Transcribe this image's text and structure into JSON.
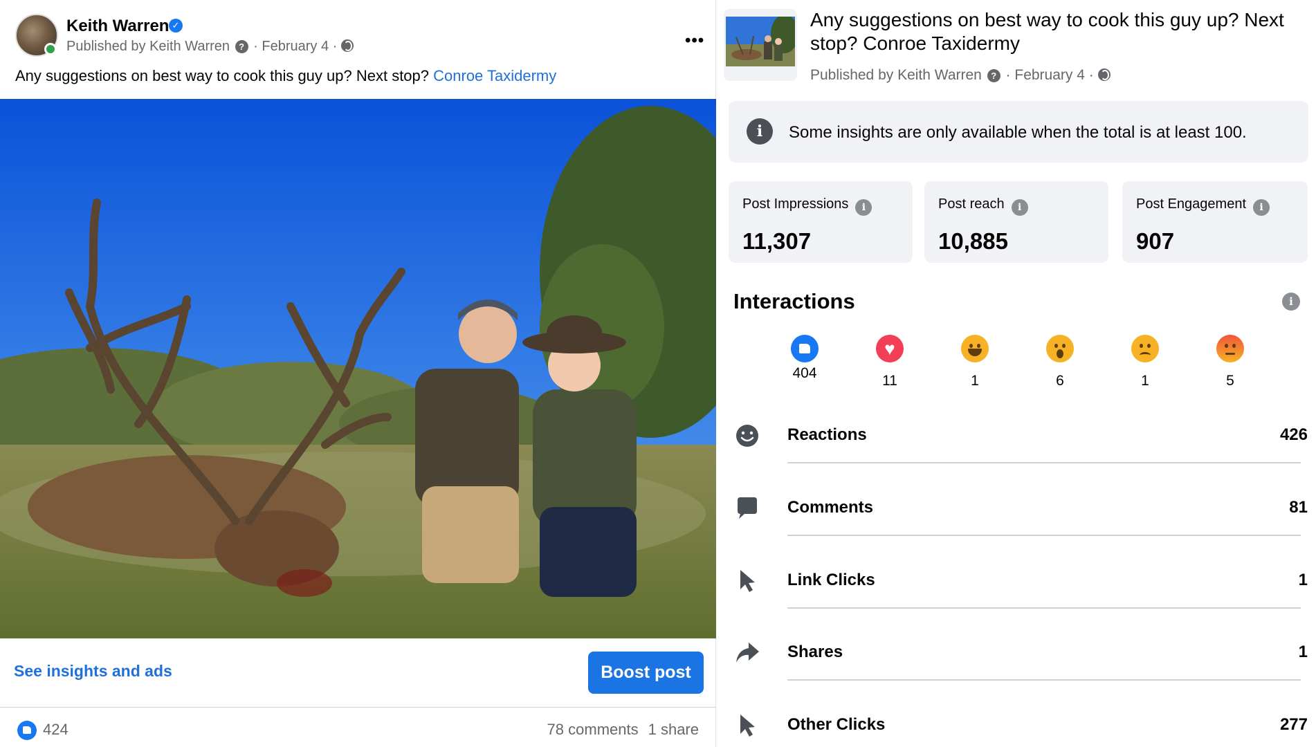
{
  "post": {
    "author": "Keith Warren",
    "published_by": "Published by Keith Warren",
    "date": "February 4",
    "caption_text": "Any suggestions on best way to cook this guy up? Next stop? ",
    "caption_link": "Conroe Taxidermy",
    "more_label": "•••",
    "insights_link": "See insights and ads",
    "boost_label": "Boost post",
    "like_count": "424",
    "comments_label": "78 comments",
    "shares_label": "1 share"
  },
  "insights": {
    "title": "Any suggestions on best way to cook this guy up? Next stop? Conroe Taxidermy",
    "published_by": "Published by Keith Warren",
    "date": "February 4",
    "notice": "Some insights are only available when the total is at least 100.",
    "stats": [
      {
        "label": "Post Impressions",
        "value": "11,307"
      },
      {
        "label": "Post reach",
        "value": "10,885"
      },
      {
        "label": "Post Engagement",
        "value": "907"
      }
    ],
    "interactions_title": "Interactions",
    "reactions": [
      {
        "name": "like",
        "icon": "like-icon",
        "count": "404"
      },
      {
        "name": "love",
        "icon": "love-icon",
        "count": "11"
      },
      {
        "name": "haha",
        "icon": "haha-icon",
        "count": "1"
      },
      {
        "name": "wow",
        "icon": "wow-icon",
        "count": "6"
      },
      {
        "name": "sad",
        "icon": "sad-icon",
        "count": "1"
      },
      {
        "name": "angry",
        "icon": "angry-icon",
        "count": "5"
      }
    ],
    "metrics": [
      {
        "label": "Reactions",
        "icon": "smiley-icon",
        "value": "426"
      },
      {
        "label": "Comments",
        "icon": "comment-bubble-icon",
        "value": "81"
      },
      {
        "label": "Link Clicks",
        "icon": "cursor-icon",
        "value": "1"
      },
      {
        "label": "Shares",
        "icon": "share-arrow-icon",
        "value": "1"
      },
      {
        "label": "Other Clicks",
        "icon": "cursor-icon",
        "value": "277"
      }
    ]
  },
  "colors": {
    "facebook_blue": "#1877f2",
    "link_blue": "#216fdb",
    "card_grey": "#f0f2f5",
    "secondary_text": "#65676b"
  }
}
